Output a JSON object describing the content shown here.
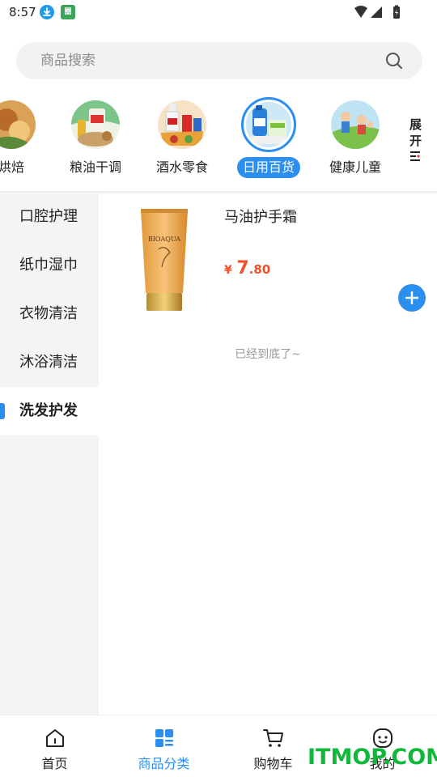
{
  "status_bar": {
    "time": "8:57",
    "app_icon_text": "圈"
  },
  "search": {
    "placeholder": "商品搜索"
  },
  "categories": [
    {
      "label": "烘焙",
      "icon": "bakery-icon"
    },
    {
      "label": "粮油干调",
      "icon": "grain-oil-icon"
    },
    {
      "label": "酒水零食",
      "icon": "drinks-snacks-icon"
    },
    {
      "label": "日用百货",
      "icon": "daily-goods-icon",
      "active": true
    },
    {
      "label": "健康儿童",
      "icon": "health-kids-icon"
    }
  ],
  "expand": {
    "label_line1": "展",
    "label_line2": "开"
  },
  "sidebar": {
    "items": [
      {
        "label": "口腔护理"
      },
      {
        "label": "纸巾湿巾"
      },
      {
        "label": "衣物清洁"
      },
      {
        "label": "沐浴清洁"
      },
      {
        "label": "洗发护发",
        "active": true
      }
    ]
  },
  "products": [
    {
      "name": "马油护手霜",
      "price_symbol": "¥",
      "price_int": "7",
      "price_dec": ".80",
      "image_text": "BIOAQUA"
    }
  ],
  "list_end_text": "已经到底了~",
  "bottom_nav": {
    "items": [
      {
        "label": "首页",
        "icon": "home-icon"
      },
      {
        "label": "商品分类",
        "icon": "category-icon",
        "active": true
      },
      {
        "label": "购物车",
        "icon": "cart-icon"
      },
      {
        "label": "我的",
        "icon": "profile-icon"
      }
    ]
  },
  "watermark": "ITMOP.COM",
  "colors": {
    "accent": "#2b8ff0",
    "price": "#f0502a",
    "watermark": "#10b83a"
  }
}
